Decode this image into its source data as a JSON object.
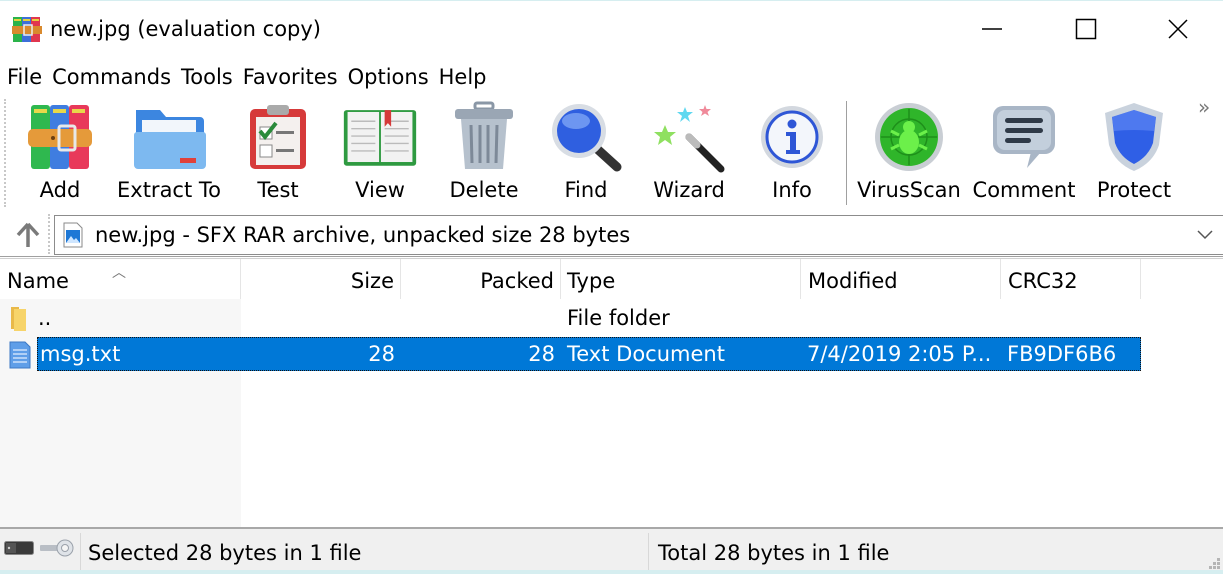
{
  "window": {
    "title": "new.jpg (evaluation copy)",
    "controls": {
      "minimize": "minimize",
      "maximize": "maximize",
      "close": "close"
    }
  },
  "menu": [
    "File",
    "Commands",
    "Tools",
    "Favorites",
    "Options",
    "Help"
  ],
  "toolbar": {
    "buttons": [
      {
        "label": "Add",
        "icon": "archive-books-icon"
      },
      {
        "label": "Extract To",
        "icon": "folder-icon"
      },
      {
        "label": "Test",
        "icon": "clipboard-check-icon"
      },
      {
        "label": "View",
        "icon": "open-book-icon"
      },
      {
        "label": "Delete",
        "icon": "trash-icon"
      },
      {
        "label": "Find",
        "icon": "magnifier-icon"
      },
      {
        "label": "Wizard",
        "icon": "magic-wand-icon"
      },
      {
        "label": "Info",
        "icon": "info-icon"
      },
      {
        "label": "VirusScan",
        "icon": "bug-scan-icon"
      },
      {
        "label": "Comment",
        "icon": "speech-bubble-icon"
      },
      {
        "label": "Protect",
        "icon": "shield-icon"
      }
    ],
    "more": "»"
  },
  "address": {
    "text": "new.jpg - SFX RAR archive, unpacked size 28 bytes"
  },
  "columns": [
    "Name",
    "Size",
    "Packed",
    "Type",
    "Modified",
    "CRC32"
  ],
  "sort": {
    "column": "Name",
    "direction": "ascending"
  },
  "files": [
    {
      "name": "..",
      "size": "",
      "packed": "",
      "type": "File folder",
      "modified": "",
      "crc32": "",
      "icon": "folder-icon",
      "selected": false
    },
    {
      "name": "msg.txt",
      "size": "28",
      "packed": "28",
      "type": "Text Document",
      "modified": "7/4/2019 2:05 P...",
      "crc32": "FB9DF6B6",
      "icon": "text-file-icon",
      "selected": true
    }
  ],
  "status": {
    "left": "Selected 28 bytes in 1 file",
    "right": "Total 28 bytes in 1 file"
  },
  "colors": {
    "selection": "#0078d7",
    "status_bg": "#f0f0f0"
  }
}
